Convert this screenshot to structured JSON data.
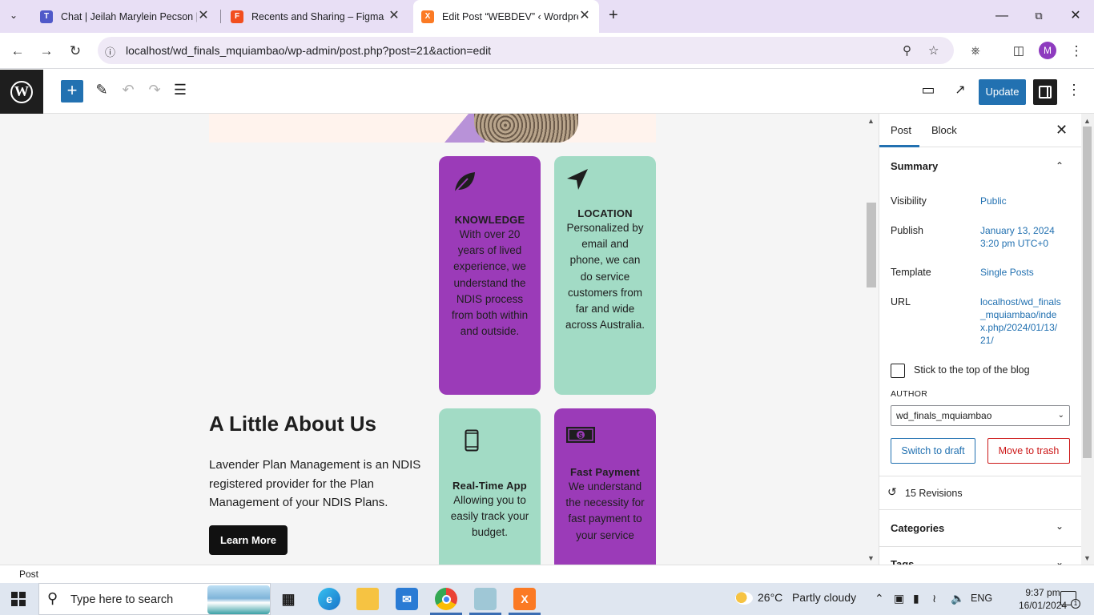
{
  "browser": {
    "tabs": [
      {
        "title": "Chat | Jeilah Marylein Pecson | M",
        "favicon": "teams",
        "favicon_color": "#5059c9"
      },
      {
        "title": "Recents and Sharing – Figma",
        "favicon": "figma",
        "favicon_color": "#f24e1e"
      },
      {
        "title": "Edit Post “WEBDEV” ‹ Wordpress",
        "favicon": "xampp",
        "favicon_color": "#fb7a24",
        "active": true
      }
    ],
    "new_tab_icon": "plus-icon",
    "url": "localhost/wd_finals_mquiambao/wp-admin/post.php?post=21&action=edit",
    "profile_initial": "M",
    "profile_color": "#8e3bbf"
  },
  "editor": {
    "update_label": "Update",
    "accent": "#2271b1"
  },
  "canvas": {
    "cards": [
      {
        "title": "KNOWLEDGE",
        "text": "With over 20 years of lived experience, we understand the NDIS process from both within and outside.",
        "icon": "leaf-icon",
        "color": "#9b3bb8"
      },
      {
        "title": "LOCATION",
        "text": "Personalized by email and phone, we can do service customers from far and wide across Australia.",
        "icon": "location-arrow-icon",
        "color": "#a2dbc5"
      },
      {
        "title": "Real-Time App",
        "text": "Allowing you to easily track your budget.",
        "icon": "mobile-phone-icon",
        "color": "#a2dbc5"
      },
      {
        "title": "Fast Payment",
        "text": "We understand the necessity for fast payment to your service",
        "icon": "money-bill-icon",
        "color": "#9b3bb8"
      }
    ],
    "about": {
      "title": "A Little About Us",
      "text": "Lavender Plan Management is an NDIS registered provider for the Plan Management of your NDIS Plans.",
      "button": "Learn More"
    }
  },
  "sidebar": {
    "tabs": [
      "Post",
      "Block"
    ],
    "summary_label": "Summary",
    "rows": [
      {
        "label": "Visibility",
        "value": "Public"
      },
      {
        "label": "Publish",
        "value": "January 13, 2024 3:20 pm UTC+0"
      },
      {
        "label": "Template",
        "value": "Single Posts"
      },
      {
        "label": "URL",
        "value": "localhost/wd_finals_mquiambao/index.php/2024/01/13/21/"
      }
    ],
    "sticky_label": "Stick to the top of the blog",
    "author_label": "AUTHOR",
    "author_value": "wd_finals_mquiambao",
    "switch_draft": "Switch to draft",
    "move_trash": "Move to trash",
    "revisions": "15 Revisions",
    "categories": "Categories",
    "tags": "Tags"
  },
  "footer": {
    "breadcrumb": "Post"
  },
  "taskbar": {
    "search_placeholder": "Type here to search",
    "weather_temp": "26°C",
    "weather_desc": "Partly cloudy",
    "language": "ENG",
    "time": "9:37 pm",
    "date": "16/01/2024",
    "notification_count": "1"
  }
}
